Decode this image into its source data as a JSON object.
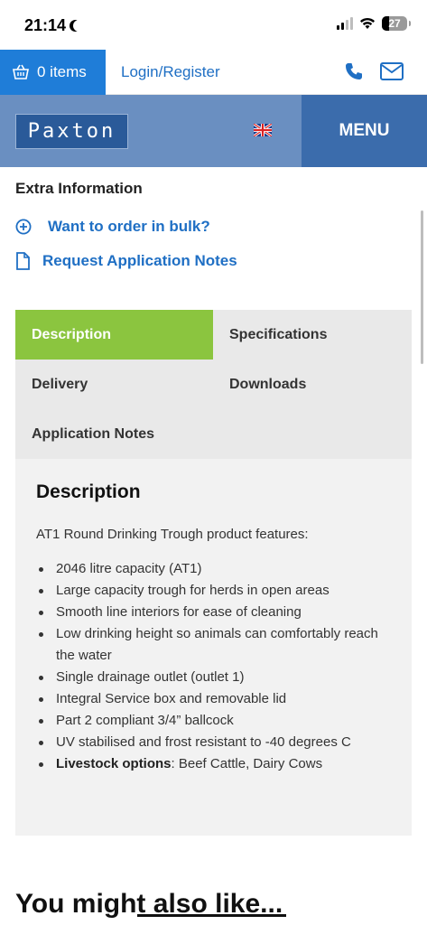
{
  "status_bar": {
    "time": "21:14",
    "battery": "27"
  },
  "top_bar": {
    "basket_label": "0 items",
    "login_label": "Login/Register"
  },
  "brand": {
    "logo_text": "Paxton",
    "menu_label": "MENU",
    "flag_icon": "uk-flag-icon"
  },
  "extra_info": {
    "title": "Extra Information",
    "bulk_label": "Want to order in bulk?",
    "notes_label": "Request Application Notes"
  },
  "tabs": [
    {
      "label": "Description",
      "active": true
    },
    {
      "label": "Specifications",
      "active": false
    },
    {
      "label": "Delivery",
      "active": false
    },
    {
      "label": "Downloads",
      "active": false
    },
    {
      "label": "Application Notes",
      "active": false
    }
  ],
  "description": {
    "heading": "Description",
    "intro": "AT1 Round Drinking Trough product features:",
    "features": [
      "2046 litre capacity (AT1)",
      "Large capacity trough for herds in open areas",
      "Smooth line interiors for ease of cleaning",
      "Low drinking height so animals can comfortably reach the water",
      "Single drainage outlet (outlet 1)",
      "Integral Service box and removable lid",
      "Part 2 compliant 3/4” ballcock",
      "UV stabilised and frost resistant to -40 degrees C"
    ],
    "livestock_label": "Livestock options",
    "livestock_value": ": Beef Cattle, Dairy Cows"
  },
  "also_like": "You might also like...",
  "colors": {
    "blue_primary": "#1f7dd8",
    "brand_bar": "#6a8fc1",
    "menu_bg": "#3b6cac",
    "tab_active": "#8bc53f",
    "link": "#1f6fc4"
  }
}
